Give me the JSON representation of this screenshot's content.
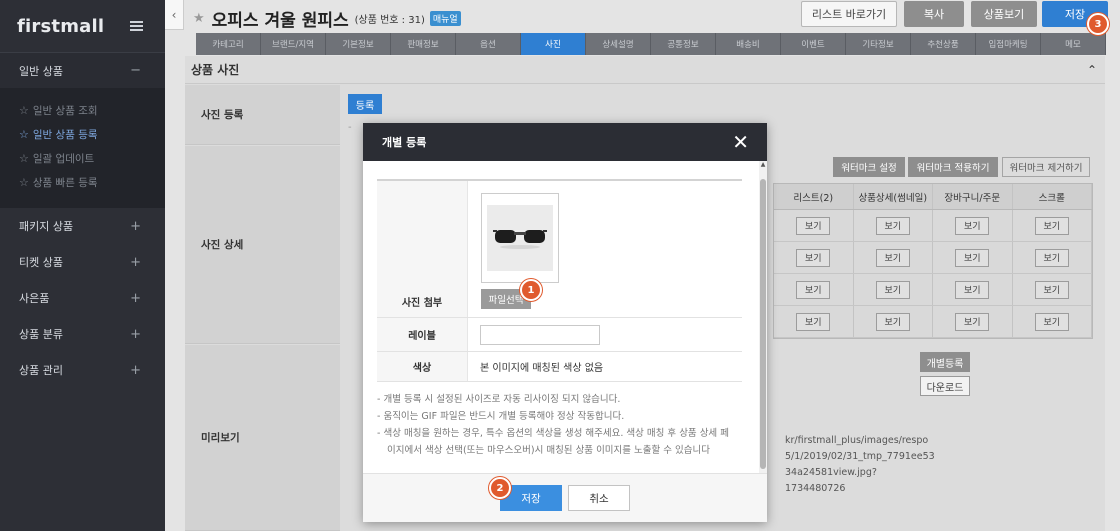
{
  "sidebar": {
    "logo": "firstmall",
    "groups": [
      {
        "label": "일반 상품",
        "sym": "−"
      },
      {
        "label": "패키지 상품",
        "sym": "+"
      },
      {
        "label": "티켓 상품",
        "sym": "+"
      },
      {
        "label": "사은품",
        "sym": "+"
      },
      {
        "label": "상품 분류",
        "sym": "+"
      },
      {
        "label": "상품 관리",
        "sym": "+"
      }
    ],
    "subitems": [
      "일반 상품 조회",
      "일반 상품 등록",
      "일괄 업데이트",
      "상품 빠른 등록"
    ]
  },
  "header": {
    "title": "오피스 겨울 원피스",
    "product_no": "(상품 번호 : 31)",
    "manual": "매뉴얼",
    "buttons": {
      "list": "리스트 바로가기",
      "copy": "복사",
      "view": "상품보기",
      "save": "저장"
    }
  },
  "tabs": [
    "카테고리",
    "브랜드/지역",
    "기본정보",
    "판매정보",
    "옵션",
    "사진",
    "상세설명",
    "공통정보",
    "배송비",
    "이벤트",
    "기타정보",
    "추천상품",
    "입점마케팅",
    "메모"
  ],
  "section": {
    "title": "상품 사진",
    "labels": {
      "register": "사진 등록",
      "detail": "사진 상세",
      "preview": "미리보기"
    },
    "register_btn": "등록",
    "dash": "-",
    "watermark": {
      "set": "워터마크 설정",
      "apply": "워터마크 적용하기",
      "remove": "워터마크 제거하기"
    },
    "grid_headers": [
      "리스트(2)",
      "상품상세(썸네일)",
      "장바구니/주문",
      "스크롤"
    ],
    "view_label": "보기",
    "individual_btn": "개별등록",
    "download_btn": "다운로드",
    "url": "kr/firstmall_plus/images/respo\n5/1/2019/02/31_tmp_7791ee53\n34a24581view.jpg?1734480726"
  },
  "modal": {
    "title": "개별 등록",
    "photo_label": "사진 첨부",
    "file_btn": "파일선택",
    "label_label": "레이블",
    "color_label": "색상",
    "color_value": "본 이미지에 매칭된 색상 없음",
    "notes": [
      "개별 등록 시 설정된 사이즈로 자동 리사이징 되지 않습니다.",
      "움직이는 GIF 파일은 반드시 개별 등록해야 정상 작동합니다.",
      "색상 매칭을 원하는 경우, 특수 옵션의 색상을 생성 해주세요. 색상 매칭 후 상품 상세 페이지에서 색상 선택(또는 마우스오버)시 매칭된 상품 이미지를 노출할 수 있습니다"
    ],
    "save": "저장",
    "cancel": "취소"
  },
  "steps": [
    "1",
    "2",
    "3"
  ],
  "colors": {
    "accent": "#2f7fd2",
    "sidebar": "#2d2f36",
    "step": "#e05a2d"
  }
}
